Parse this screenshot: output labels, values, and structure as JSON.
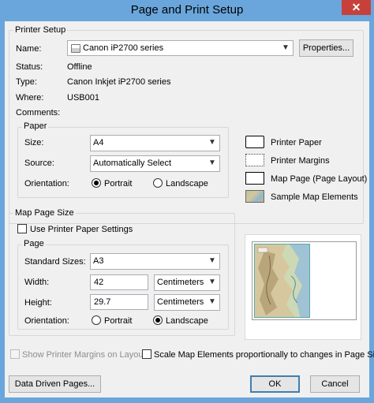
{
  "window": {
    "title": "Page and Print Setup",
    "close_glyph": "✕"
  },
  "printer_setup": {
    "legend": "Printer Setup",
    "name_label": "Name:",
    "name_value": "Canon iP2700 series",
    "properties_button": "Properties...",
    "status_label": "Status:",
    "status_value": "Offline",
    "type_label": "Type:",
    "type_value": "Canon Inkjet iP2700 series",
    "where_label": "Where:",
    "where_value": "USB001",
    "comments_label": "Comments:",
    "comments_value": ""
  },
  "paper": {
    "legend": "Paper",
    "size_label": "Size:",
    "size_value": "A4",
    "source_label": "Source:",
    "source_value": "Automatically Select",
    "orientation_label": "Orientation:",
    "portrait_label": "Portrait",
    "landscape_label": "Landscape",
    "selected_orientation": "portrait"
  },
  "legend_items": [
    {
      "label": "Printer Paper",
      "icon": "printer-paper-swatch"
    },
    {
      "label": "Printer Margins",
      "icon": "printer-margins-swatch"
    },
    {
      "label": "Map Page (Page Layout)",
      "icon": "map-page-swatch"
    },
    {
      "label": "Sample Map Elements",
      "icon": "sample-map-elements-swatch"
    }
  ],
  "map_page_size": {
    "legend": "Map Page Size",
    "use_printer_paper_label": "Use Printer Paper Settings",
    "use_printer_paper_checked": false,
    "page_legend": "Page",
    "standard_sizes_label": "Standard Sizes:",
    "standard_sizes_value": "A3",
    "width_label": "Width:",
    "width_value": "42",
    "width_unit": "Centimeters",
    "height_label": "Height:",
    "height_value": "29.7",
    "height_unit": "Centimeters",
    "orientation_label": "Orientation:",
    "portrait_label": "Portrait",
    "landscape_label": "Landscape",
    "selected_orientation": "landscape"
  },
  "options": {
    "show_margins_label": "Show Printer Margins on Layout",
    "show_margins_checked": false,
    "show_margins_enabled": false,
    "scale_elements_label": "Scale Map Elements proportionally to changes in Page Size",
    "scale_elements_checked": false
  },
  "buttons": {
    "data_driven_pages": "Data Driven Pages...",
    "ok": "OK",
    "cancel": "Cancel"
  },
  "colors": {
    "titlebar": "#6aa6dc",
    "close_button": "#c7413a",
    "dialog_background": "#f0f0f0"
  }
}
